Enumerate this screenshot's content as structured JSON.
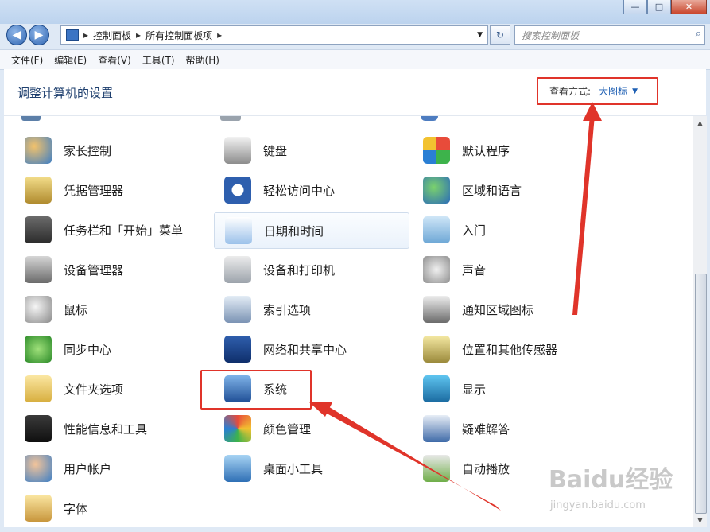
{
  "window": {
    "minimize": "—",
    "maximize": "□",
    "close": "✕"
  },
  "nav": {
    "back": "◀",
    "forward": "▶",
    "breadcrumb": [
      "控制面板",
      "所有控制面板项"
    ],
    "search_placeholder": "搜索控制面板",
    "refresh": "↻",
    "search_icon": "search-icon"
  },
  "menu": [
    "文件(F)",
    "编辑(E)",
    "查看(V)",
    "工具(T)",
    "帮助(H)"
  ],
  "header": {
    "title": "调整计算机的设置",
    "viewby_label": "查看方式:",
    "viewby_value": "大图标"
  },
  "items": [
    {
      "label": "家长控制",
      "icon": "parental-control-icon"
    },
    {
      "label": "键盘",
      "icon": "keyboard-icon"
    },
    {
      "label": "默认程序",
      "icon": "default-programs-icon"
    },
    {
      "label": "凭据管理器",
      "icon": "credential-manager-icon"
    },
    {
      "label": "轻松访问中心",
      "icon": "ease-of-access-icon"
    },
    {
      "label": "区域和语言",
      "icon": "region-language-icon"
    },
    {
      "label": "任务栏和「开始」菜单",
      "icon": "taskbar-icon"
    },
    {
      "label": "日期和时间",
      "icon": "date-time-icon"
    },
    {
      "label": "入门",
      "icon": "getting-started-icon"
    },
    {
      "label": "设备管理器",
      "icon": "device-manager-icon"
    },
    {
      "label": "设备和打印机",
      "icon": "devices-printers-icon"
    },
    {
      "label": "声音",
      "icon": "sound-icon"
    },
    {
      "label": "鼠标",
      "icon": "mouse-icon"
    },
    {
      "label": "索引选项",
      "icon": "indexing-icon"
    },
    {
      "label": "通知区域图标",
      "icon": "notification-icon"
    },
    {
      "label": "同步中心",
      "icon": "sync-center-icon"
    },
    {
      "label": "网络和共享中心",
      "icon": "network-icon"
    },
    {
      "label": "位置和其他传感器",
      "icon": "location-sensors-icon"
    },
    {
      "label": "文件夹选项",
      "icon": "folder-options-icon"
    },
    {
      "label": "系统",
      "icon": "system-icon"
    },
    {
      "label": "显示",
      "icon": "display-icon"
    },
    {
      "label": "性能信息和工具",
      "icon": "performance-icon"
    },
    {
      "label": "颜色管理",
      "icon": "color-management-icon"
    },
    {
      "label": "疑难解答",
      "icon": "troubleshooting-icon"
    },
    {
      "label": "用户帐户",
      "icon": "user-accounts-icon"
    },
    {
      "label": "桌面小工具",
      "icon": "gadgets-icon"
    },
    {
      "label": "自动播放",
      "icon": "autoplay-icon"
    },
    {
      "label": "字体",
      "icon": "fonts-icon"
    }
  ],
  "watermark": {
    "brand": "Baidu经验",
    "url": "jingyan.baidu.com"
  },
  "colors": {
    "annotation": "#e0342a",
    "link": "#1e5fb3"
  }
}
